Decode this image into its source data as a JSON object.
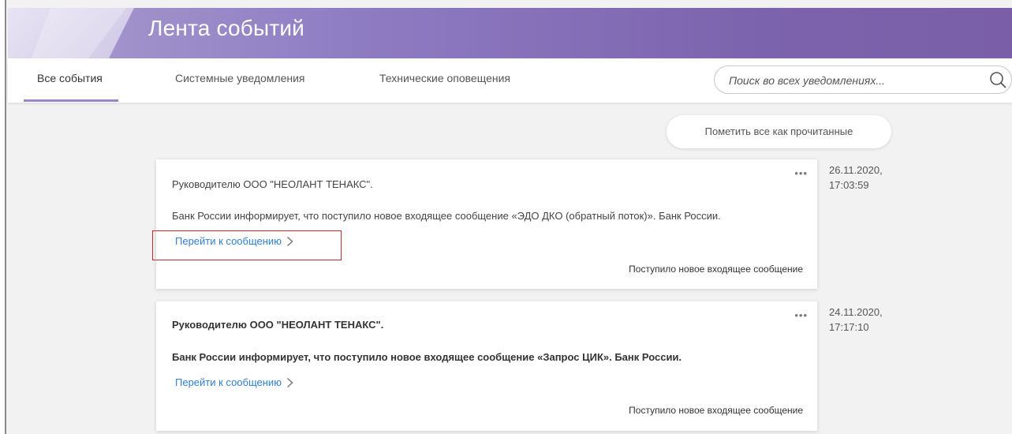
{
  "header": {
    "title": "Лента событий"
  },
  "tabs": [
    {
      "label": "Все события",
      "active": true
    },
    {
      "label": "Системные уведомления",
      "active": false
    },
    {
      "label": "Технические оповещения",
      "active": false
    }
  ],
  "search": {
    "placeholder": "Поиск во всех уведомлениях...",
    "icon": "search-icon"
  },
  "actions": {
    "mark_all_read": "Пометить все как прочитанные"
  },
  "notifications": [
    {
      "addressee": "Руководителю ООО \"НЕОЛАНТ ТЕНАКС\".",
      "body": "Банк России информирует, что поступило новое входящее сообщение «ЭДО ДКО (обратный поток)». Банк России.",
      "link": "Перейти к сообщению",
      "category": "Поступило новое входящее сообщение",
      "date": "26.11.2020,",
      "time": "17:03:59",
      "read": true,
      "more": "•••"
    },
    {
      "addressee": "Руководителю ООО \"НЕОЛАНТ ТЕНАКС\".",
      "body": "Банк России информирует, что поступило новое входящее сообщение «Запрос ЦИК». Банк России.",
      "link": "Перейти к сообщению",
      "category": "Поступило новое входящее сообщение",
      "date": "24.11.2020,",
      "time": "17:17:10",
      "read": false,
      "more": "•••"
    }
  ],
  "colors": {
    "accent": "#9a86c8",
    "link": "#2f7fd0",
    "highlight_border": "#c8282f",
    "header_gradient_start": "#a99ccf",
    "header_gradient_end": "#7a5fa8"
  }
}
